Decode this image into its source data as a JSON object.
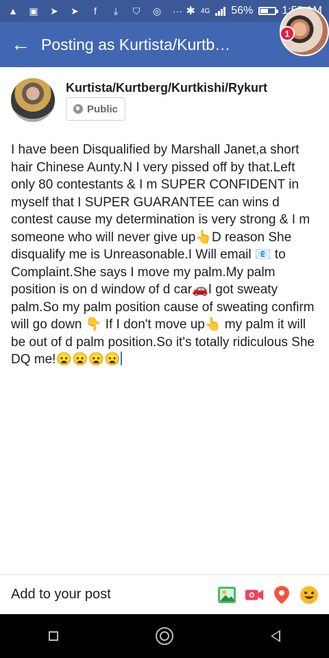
{
  "status_bar": {
    "network": "4G",
    "battery": "56%",
    "battery_level": 0.56,
    "time": "1:58 AM"
  },
  "header": {
    "title": "Posting as Kurtista/Kurtb…",
    "notification_count": "1"
  },
  "author": {
    "name": "Kurtista/Kurtberg/Kurtkishi/Rykurt",
    "privacy": "Public"
  },
  "post": {
    "text": "I have been Disqualified by Marshall Janet,a short hair Chinese Aunty.N I very pissed off by that.Left only 80 contestants & I m SUPER CONFIDENT in myself that I SUPER GUARANTEE can wins d contest cause my determination is very strong & I m someone who will never give up👆D reason She disqualify me is Unreasonable.I Will email 📧 to Complaint.She says I move my palm.My palm position is on d window of d car🚗I got sweaty palm.So my palm position cause of sweating confirm will go down 👇 If I don't move up👆 my palm it will be out of d palm position.So it's totally ridiculous She DQ me!😦😦😦😦"
  },
  "add_bar": {
    "label": "Add to your post",
    "icons": [
      "photo-icon",
      "live-video-icon",
      "location-pin-icon",
      "feeling-emoji-icon"
    ]
  },
  "colors": {
    "statusbar": "#3b5998",
    "appbar": "#4267b2",
    "badge": "#e41e3f"
  }
}
